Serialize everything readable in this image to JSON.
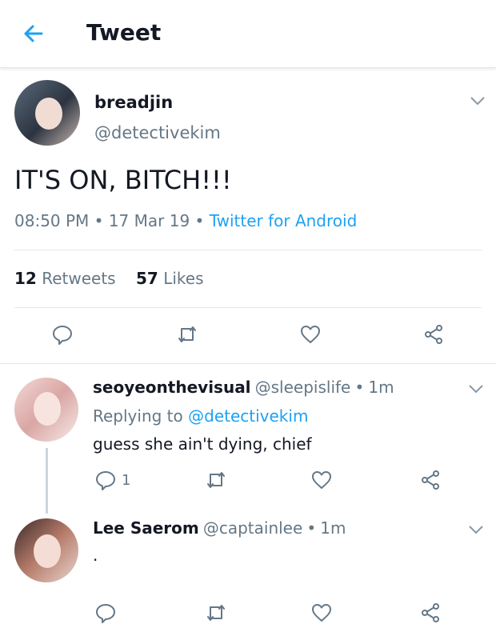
{
  "header": {
    "title": "Tweet",
    "back_icon": "arrow-left-icon",
    "accent": "#1da1f2"
  },
  "tweet": {
    "display_name": "breadjin",
    "handle": "@detectivekim",
    "text": "IT'S ON, BITCH!!!",
    "time": "08:50 PM",
    "date": "17 Mar 19",
    "source": "Twitter for Android",
    "retweets_count": "12",
    "retweets_label": "Retweets",
    "likes_count": "57",
    "likes_label": "Likes"
  },
  "replies": [
    {
      "display_name": "seoyeonthevisual",
      "handle": "@sleepislife",
      "time": "1m",
      "replying_prefix": "Replying to",
      "replying_to": "@detectivekim",
      "text": "guess she ain't dying, chief",
      "reply_count": "1"
    },
    {
      "display_name": "Lee Saerom",
      "handle": "@captainlee",
      "time": "1m",
      "text": "."
    }
  ],
  "sep": "•"
}
